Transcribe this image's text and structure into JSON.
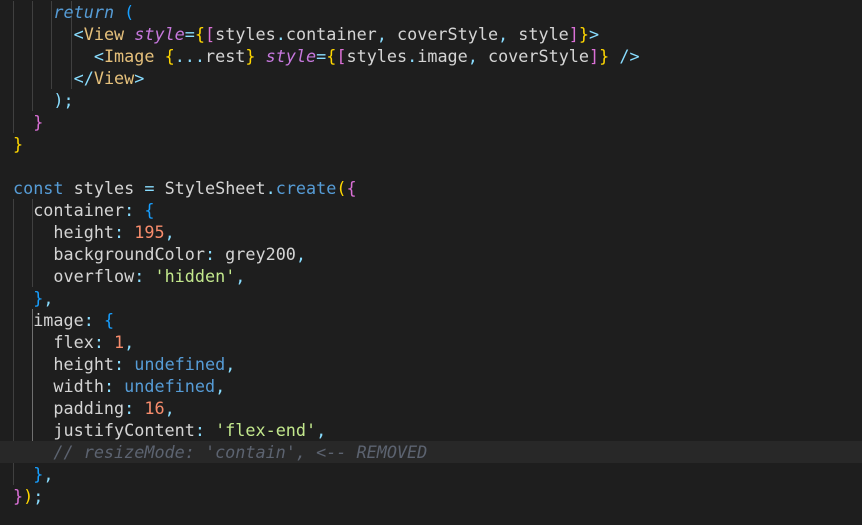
{
  "editor": {
    "language": "javascript",
    "lines": [
      {
        "tokens": [
          {
            "t": "    ",
            "c": "plain"
          },
          {
            "t": "return",
            "c": "kw-ctrl"
          },
          {
            "t": " ",
            "c": "plain"
          },
          {
            "t": "(",
            "c": "b3"
          }
        ]
      },
      {
        "tokens": [
          {
            "t": "      ",
            "c": "plain"
          },
          {
            "t": "<",
            "c": "punc"
          },
          {
            "t": "View",
            "c": "tag"
          },
          {
            "t": " ",
            "c": "plain"
          },
          {
            "t": "style",
            "c": "attr"
          },
          {
            "t": "=",
            "c": "punc"
          },
          {
            "t": "{",
            "c": "b1"
          },
          {
            "t": "[",
            "c": "b2"
          },
          {
            "t": "styles",
            "c": "id"
          },
          {
            "t": ".",
            "c": "punc"
          },
          {
            "t": "container",
            "c": "prop"
          },
          {
            "t": ",",
            "c": "punc"
          },
          {
            "t": " coverStyle",
            "c": "id"
          },
          {
            "t": ",",
            "c": "punc"
          },
          {
            "t": " style",
            "c": "id"
          },
          {
            "t": "]",
            "c": "b2"
          },
          {
            "t": "}",
            "c": "b1"
          },
          {
            "t": ">",
            "c": "punc"
          }
        ]
      },
      {
        "tokens": [
          {
            "t": "        ",
            "c": "plain"
          },
          {
            "t": "<",
            "c": "punc"
          },
          {
            "t": "Image",
            "c": "tag"
          },
          {
            "t": " ",
            "c": "plain"
          },
          {
            "t": "{",
            "c": "b1"
          },
          {
            "t": "...",
            "c": "punc"
          },
          {
            "t": "rest",
            "c": "id"
          },
          {
            "t": "}",
            "c": "b1"
          },
          {
            "t": " ",
            "c": "plain"
          },
          {
            "t": "style",
            "c": "attr"
          },
          {
            "t": "=",
            "c": "punc"
          },
          {
            "t": "{",
            "c": "b1"
          },
          {
            "t": "[",
            "c": "b2"
          },
          {
            "t": "styles",
            "c": "id"
          },
          {
            "t": ".",
            "c": "punc"
          },
          {
            "t": "image",
            "c": "prop"
          },
          {
            "t": ",",
            "c": "punc"
          },
          {
            "t": " coverStyle",
            "c": "id"
          },
          {
            "t": "]",
            "c": "b2"
          },
          {
            "t": "}",
            "c": "b1"
          },
          {
            "t": " />",
            "c": "punc"
          }
        ]
      },
      {
        "tokens": [
          {
            "t": "      ",
            "c": "plain"
          },
          {
            "t": "</",
            "c": "punc"
          },
          {
            "t": "View",
            "c": "tag"
          },
          {
            "t": ">",
            "c": "punc"
          }
        ]
      },
      {
        "tokens": [
          {
            "t": "    ",
            "c": "plain"
          },
          {
            "t": ");",
            "c": "punc"
          }
        ]
      },
      {
        "tokens": [
          {
            "t": "  ",
            "c": "plain"
          },
          {
            "t": "}",
            "c": "b2"
          }
        ]
      },
      {
        "tokens": [
          {
            "t": "}",
            "c": "b1"
          }
        ]
      },
      {
        "tokens": []
      },
      {
        "tokens": [
          {
            "t": "const",
            "c": "kw"
          },
          {
            "t": " styles ",
            "c": "id"
          },
          {
            "t": "=",
            "c": "punc"
          },
          {
            "t": " StyleSheet",
            "c": "id"
          },
          {
            "t": ".",
            "c": "punc"
          },
          {
            "t": "create",
            "c": "fn"
          },
          {
            "t": "(",
            "c": "b1"
          },
          {
            "t": "{",
            "c": "b2"
          }
        ]
      },
      {
        "tokens": [
          {
            "t": "  container",
            "c": "prop"
          },
          {
            "t": ":",
            "c": "punc"
          },
          {
            "t": " ",
            "c": "plain"
          },
          {
            "t": "{",
            "c": "b3"
          }
        ]
      },
      {
        "tokens": [
          {
            "t": "    height",
            "c": "prop"
          },
          {
            "t": ":",
            "c": "punc"
          },
          {
            "t": " ",
            "c": "plain"
          },
          {
            "t": "195",
            "c": "num"
          },
          {
            "t": ",",
            "c": "punc"
          }
        ]
      },
      {
        "tokens": [
          {
            "t": "    backgroundColor",
            "c": "prop"
          },
          {
            "t": ":",
            "c": "punc"
          },
          {
            "t": " grey200",
            "c": "id"
          },
          {
            "t": ",",
            "c": "punc"
          }
        ]
      },
      {
        "tokens": [
          {
            "t": "    overflow",
            "c": "prop"
          },
          {
            "t": ":",
            "c": "punc"
          },
          {
            "t": " ",
            "c": "plain"
          },
          {
            "t": "'hidden'",
            "c": "str"
          },
          {
            "t": ",",
            "c": "punc"
          }
        ]
      },
      {
        "tokens": [
          {
            "t": "  ",
            "c": "plain"
          },
          {
            "t": "}",
            "c": "b3"
          },
          {
            "t": ",",
            "c": "punc"
          }
        ]
      },
      {
        "tokens": [
          {
            "t": "  image",
            "c": "prop"
          },
          {
            "t": ":",
            "c": "punc"
          },
          {
            "t": " ",
            "c": "plain"
          },
          {
            "t": "{",
            "c": "b3"
          }
        ]
      },
      {
        "tokens": [
          {
            "t": "    flex",
            "c": "prop"
          },
          {
            "t": ":",
            "c": "punc"
          },
          {
            "t": " ",
            "c": "plain"
          },
          {
            "t": "1",
            "c": "num"
          },
          {
            "t": ",",
            "c": "punc"
          }
        ]
      },
      {
        "tokens": [
          {
            "t": "    height",
            "c": "prop"
          },
          {
            "t": ":",
            "c": "punc"
          },
          {
            "t": " ",
            "c": "plain"
          },
          {
            "t": "undefined",
            "c": "undef"
          },
          {
            "t": ",",
            "c": "punc"
          }
        ]
      },
      {
        "tokens": [
          {
            "t": "    width",
            "c": "prop"
          },
          {
            "t": ":",
            "c": "punc"
          },
          {
            "t": " ",
            "c": "plain"
          },
          {
            "t": "undefined",
            "c": "undef"
          },
          {
            "t": ",",
            "c": "punc"
          }
        ]
      },
      {
        "tokens": [
          {
            "t": "    padding",
            "c": "prop"
          },
          {
            "t": ":",
            "c": "punc"
          },
          {
            "t": " ",
            "c": "plain"
          },
          {
            "t": "16",
            "c": "num"
          },
          {
            "t": ",",
            "c": "punc"
          }
        ]
      },
      {
        "tokens": [
          {
            "t": "    justifyContent",
            "c": "prop"
          },
          {
            "t": ":",
            "c": "punc"
          },
          {
            "t": " ",
            "c": "plain"
          },
          {
            "t": "'flex-end'",
            "c": "str"
          },
          {
            "t": ",",
            "c": "punc"
          }
        ]
      },
      {
        "tokens": [
          {
            "t": "    // resizeMode: 'contain', <-- REMOVED",
            "c": "cmt"
          }
        ]
      },
      {
        "tokens": [
          {
            "t": "  ",
            "c": "plain"
          },
          {
            "t": "}",
            "c": "b3"
          },
          {
            "t": ",",
            "c": "punc"
          }
        ]
      },
      {
        "tokens": [
          {
            "t": "}",
            "c": "b2"
          },
          {
            "t": ")",
            "c": "b1"
          },
          {
            "t": ";",
            "c": "punc"
          }
        ]
      }
    ]
  }
}
